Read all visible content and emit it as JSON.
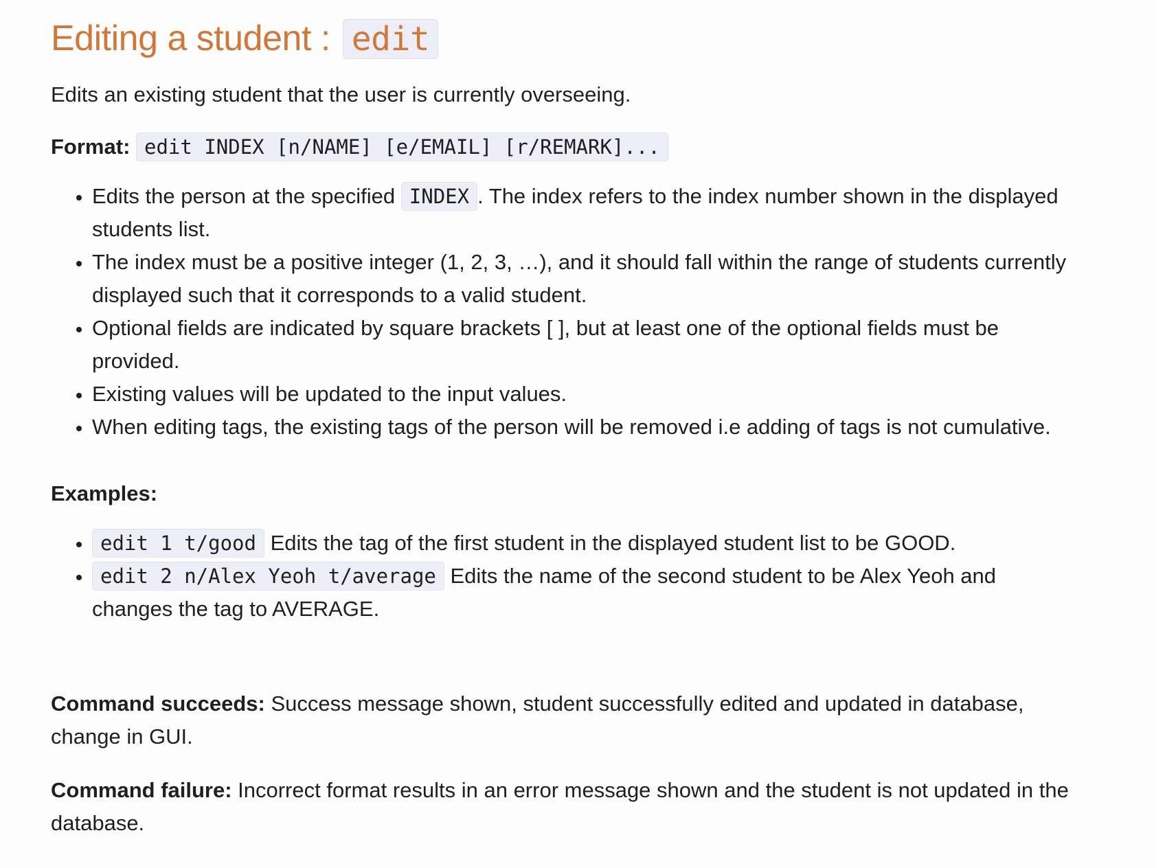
{
  "heading": {
    "text": "Editing a student : ",
    "code": "edit"
  },
  "intro": "Edits an existing student that the user is currently overseeing.",
  "format": {
    "label": "Format:",
    "code": "edit INDEX [n/NAME] [e/EMAIL] [r/REMARK]..."
  },
  "notes": {
    "item1_pre": "Edits the person at the specified ",
    "item1_code": "INDEX",
    "item1_post": ". The index refers to the index number shown in the displayed students list.",
    "item2": "The index must be a positive integer (1, 2, 3, …), and it should fall within the range of students currently displayed such that it corresponds to a valid student.",
    "item3": "Optional fields are indicated by square brackets [ ], but at least one of the optional fields must be provided.",
    "item4": "Existing values will be updated to the input values.",
    "item5": "When editing tags, the existing tags of the person will be removed i.e adding of tags is not cumulative."
  },
  "examples": {
    "label": "Examples:",
    "ex1_code": "edit 1 t/good",
    "ex1_text": " Edits the tag of the first student in the displayed student list to be GOOD.",
    "ex2_code": "edit 2 n/Alex Yeoh t/average",
    "ex2_text": " Edits the name of the second student to be Alex Yeoh and changes the tag to AVERAGE."
  },
  "success": {
    "label": "Command succeeds:",
    "text": " Success message shown, student successfully edited and updated in database, change in GUI."
  },
  "failure": {
    "label": "Command failure:",
    "text": " Incorrect format results in an error message shown and the student is not updated in the database."
  }
}
